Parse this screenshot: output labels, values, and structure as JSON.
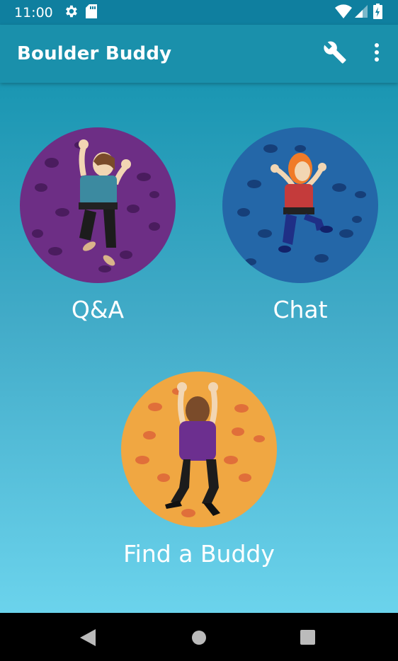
{
  "status_bar": {
    "time": "11:00"
  },
  "app_bar": {
    "title": "Boulder Buddy",
    "settings_icon": "wrench-icon",
    "menu_icon": "more-vert-icon"
  },
  "tiles": [
    {
      "label": "Q&A",
      "color": "#6d2e85",
      "hold_color": "#4a1c5e"
    },
    {
      "label": "Chat",
      "color": "#2467a8",
      "hold_color": "#163f79"
    },
    {
      "label": "Find a Buddy",
      "color": "#f0a742",
      "hold_color": "#e06f3a"
    }
  ],
  "nav_bar": {
    "back_icon": "back-triangle-icon",
    "home_icon": "home-circle-icon",
    "recents_icon": "recents-square-icon"
  }
}
